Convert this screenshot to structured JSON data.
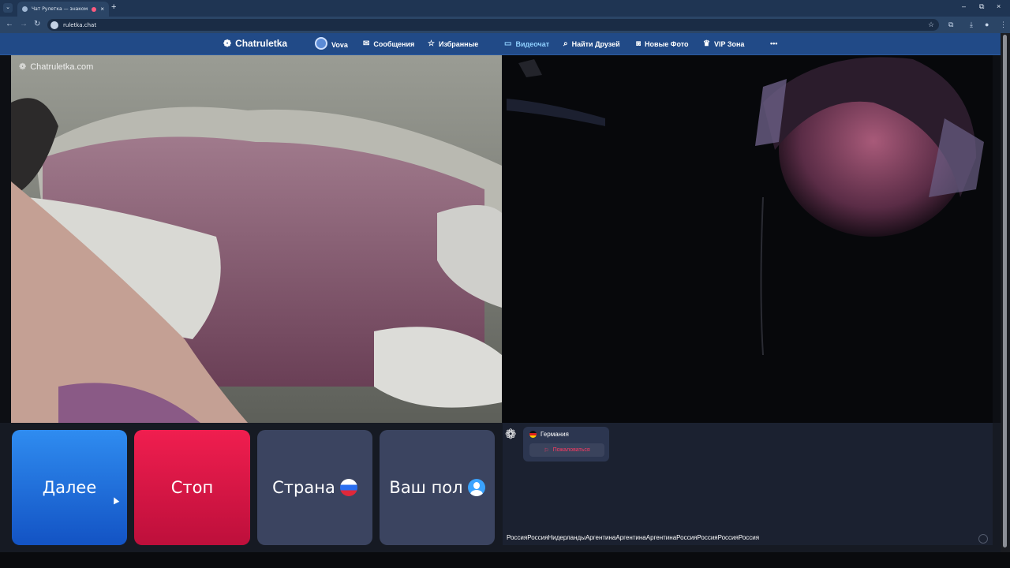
{
  "browser": {
    "tab_title": "Чат Рулетка — знакомства",
    "tab_close": "×",
    "new_tab": "+",
    "url": "ruletka.chat",
    "window_controls": [
      "–",
      "⧉",
      "×"
    ]
  },
  "site": {
    "brand": "Chatruletka",
    "user_name": "Vova",
    "nav": [
      {
        "label": "Сообщения",
        "icon": "mail-icon"
      },
      {
        "label": "Избранные",
        "icon": "star-icon"
      },
      {
        "label": "Видеочат",
        "icon": "video-icon",
        "active": true
      },
      {
        "label": "Найти Друзей",
        "icon": "search-icon"
      },
      {
        "label": "Новые Фото",
        "icon": "camera-icon"
      },
      {
        "label": "VIP Зона",
        "icon": "crown-icon"
      }
    ],
    "more": "•••"
  },
  "video": {
    "watermark": "Chatruletka.com"
  },
  "controls": {
    "next": "Далее",
    "stop": "Стоп",
    "country": "Страна",
    "gender": "Ваш пол"
  },
  "partner": {
    "country": "Германия",
    "report": "Пожаловаться"
  },
  "chat_log": "РоссияРоссияНидерландыАргентинаАргентинаАргентинаРоссияРоссияРоссияРоссия",
  "colors": {
    "header": "#214a87",
    "next_button": "#1f6fe0",
    "stop_button": "#e01545",
    "secondary_button": "#3b4460",
    "report_text": "#ff3a63"
  }
}
